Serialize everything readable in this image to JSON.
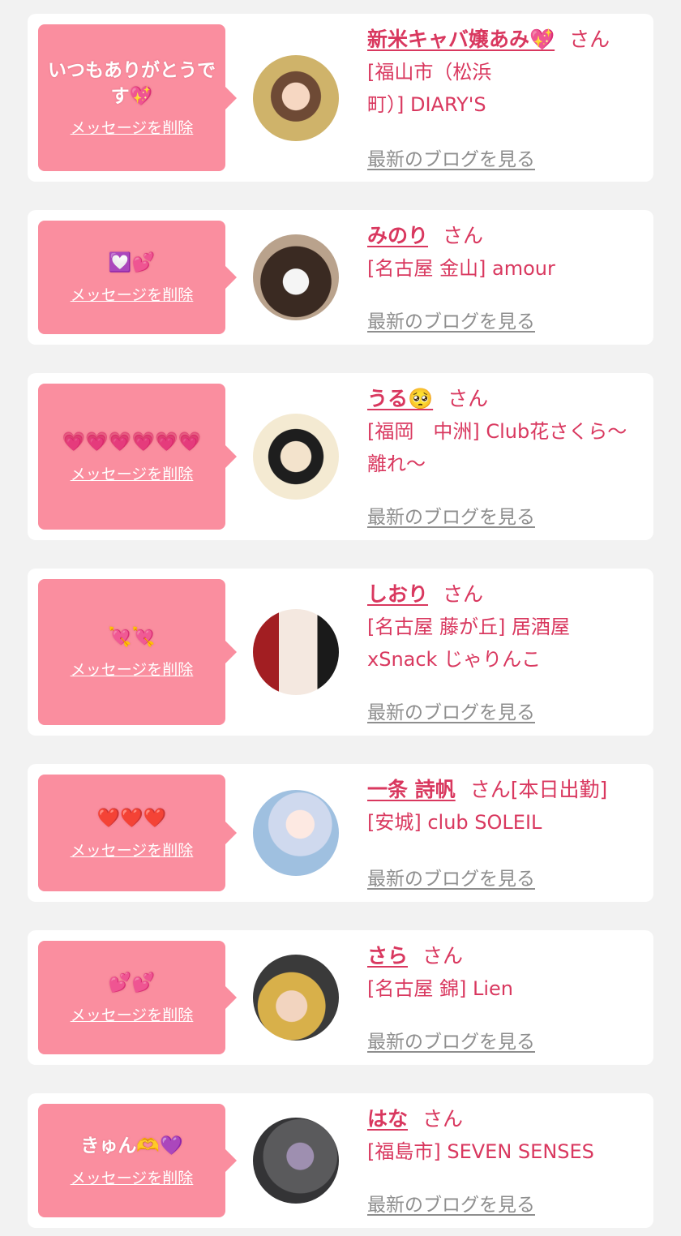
{
  "common": {
    "delete_label": "メッセージを削除",
    "blog_label": "最新のブログを見る",
    "san": "さん"
  },
  "items": [
    {
      "message": "いつもありがとうです💖",
      "name": "新米キャバ嬢あみ💖",
      "extra": "",
      "shop": "[福山市（松浜町）] DIARY'S"
    },
    {
      "message": "💟💕",
      "name": "みのり",
      "extra": "",
      "shop": "[名古屋 金山] amour"
    },
    {
      "message": "💗💗💗💗💗💗",
      "name": "うる🥺",
      "extra": "",
      "shop": "[福岡　中洲] Club花さくら～離れ～"
    },
    {
      "message": "💘💘",
      "name": "しおり",
      "extra": "",
      "shop": "[名古屋 藤が丘] 居酒屋xSnack じゃりんこ"
    },
    {
      "message": "❤️❤️❤️",
      "name": "一条 詩帆",
      "extra": "[本日出勤]",
      "shop": "[安城] club SOLEIL"
    },
    {
      "message": "💕💕",
      "name": "さら",
      "extra": "",
      "shop": "[名古屋 錦] Lien"
    },
    {
      "message": "きゅん🫶💜",
      "name": "はな",
      "extra": "",
      "shop": "[福島市] SEVEN SENSES"
    }
  ],
  "colors": {
    "background": "#f2f2f2",
    "card": "#ffffff",
    "bubble": "#fa8e9f",
    "name_text": "#d9385f",
    "blog_link": "#8e8e8e"
  }
}
